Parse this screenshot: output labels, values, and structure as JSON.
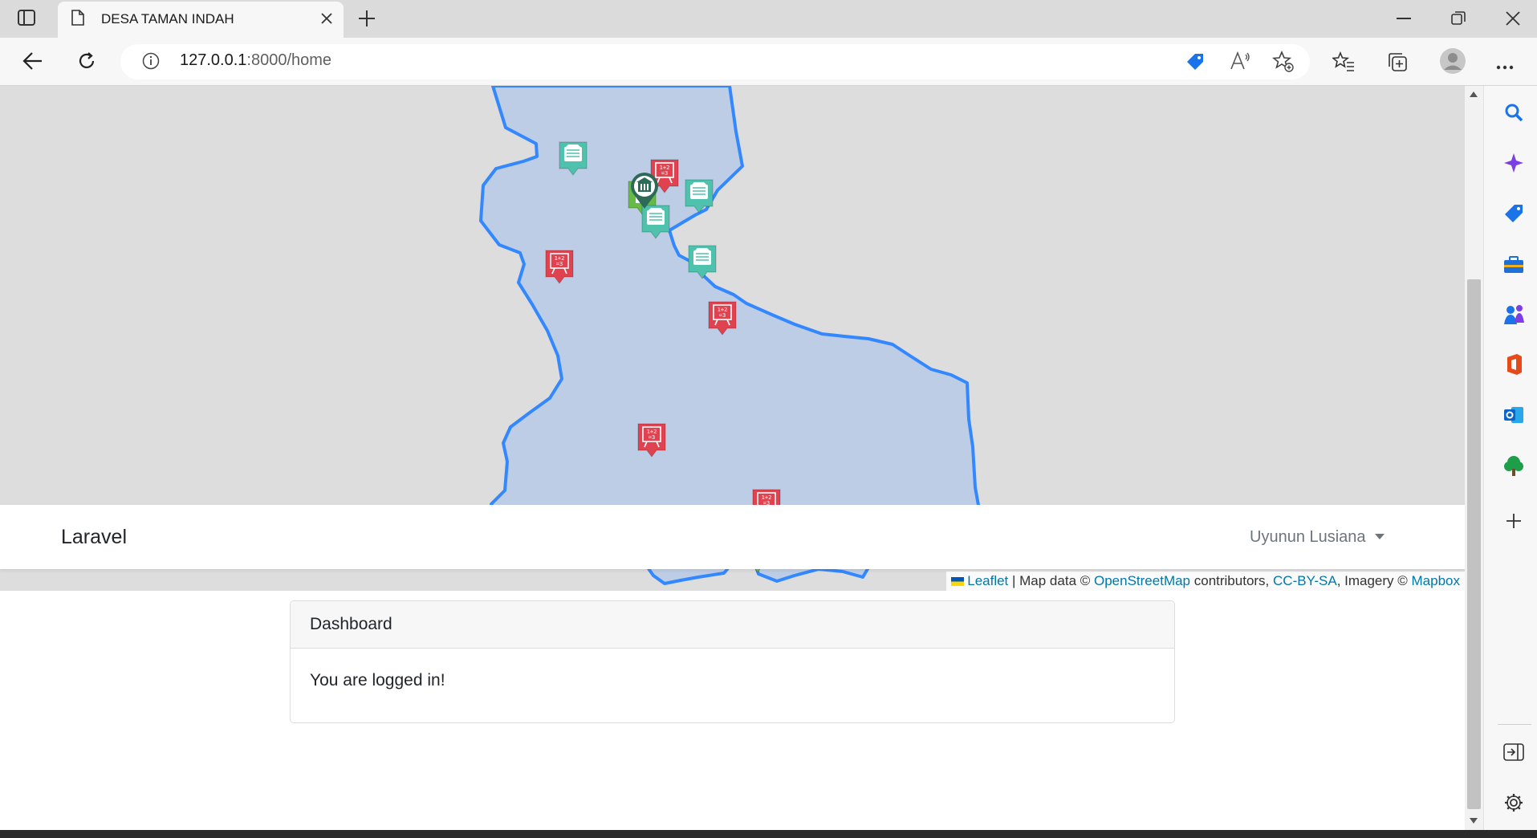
{
  "browser": {
    "tab_title": "DESA TAMAN INDAH",
    "url_host": "127.0.0.1",
    "url_path": ":8000/home"
  },
  "map": {
    "attribution": {
      "leaflet": "Leaflet",
      "sep1": " | Map data © ",
      "osm": "OpenStreetMap",
      "contrib": " contributors, ",
      "license": "CC-BY-SA",
      "imagery": ", Imagery © ",
      "mapbox": "Mapbox"
    },
    "marker_types": {
      "school_marker": "red",
      "office_marker": "teal",
      "mosque_marker": "green",
      "government_marker": "dark-green"
    },
    "colors": {
      "boundary_stroke": "#3388ff",
      "boundary_fill": "#b9cbe6",
      "school": "#e0434f",
      "office": "#4fc2ad",
      "mosque": "#66bb44"
    }
  },
  "navbar": {
    "brand": "Laravel",
    "user": "Uyunun Lusiana"
  },
  "card": {
    "header": "Dashboard",
    "body": "You are logged in!"
  }
}
